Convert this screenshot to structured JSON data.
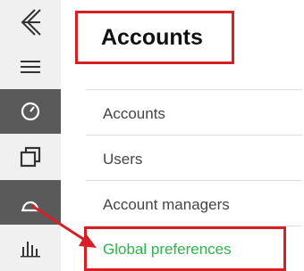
{
  "sidebar": {
    "items": [
      {
        "icon": "logo-icon"
      },
      {
        "icon": "hamburger-menu-icon"
      },
      {
        "icon": "dashboard-gauge-icon"
      },
      {
        "icon": "copy-windows-icon"
      },
      {
        "icon": "accounts-search-icon"
      },
      {
        "icon": "bar-chart-icon"
      }
    ]
  },
  "main": {
    "title": "Accounts",
    "menu": [
      {
        "label": "Accounts"
      },
      {
        "label": "Users"
      },
      {
        "label": "Account managers"
      },
      {
        "label": "Global preferences",
        "active": true
      }
    ]
  },
  "colors": {
    "highlight": "#d91f26",
    "active_text": "#2eb34a",
    "rail_dark": "#5a5a5a"
  }
}
